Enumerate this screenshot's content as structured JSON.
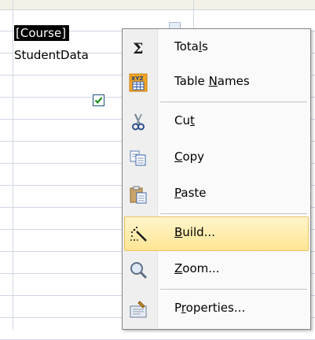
{
  "grid": {
    "cells": {
      "course_field": "[Course]",
      "table_name": "StudentData"
    },
    "checkbox_checked": true
  },
  "context_menu": {
    "items": [
      {
        "pre": "Tota",
        "key": "l",
        "post": "s",
        "icon": "sigma-icon"
      },
      {
        "pre": "Table ",
        "key": "N",
        "post": "ames",
        "icon": "table-names-icon"
      },
      {
        "pre": "Cu",
        "key": "t",
        "post": "",
        "icon": "scissors-icon"
      },
      {
        "pre": "",
        "key": "C",
        "post": "opy",
        "icon": "copy-icon"
      },
      {
        "pre": "",
        "key": "P",
        "post": "aste",
        "icon": "clipboard-icon"
      },
      {
        "pre": "",
        "key": "B",
        "post": "uild...",
        "icon": "build-wand-icon",
        "highlighted": true
      },
      {
        "pre": "",
        "key": "Z",
        "post": "oom...",
        "icon": "magnifier-icon"
      },
      {
        "pre": "P",
        "key": "r",
        "post": "operties...",
        "icon": "properties-icon"
      }
    ]
  },
  "colors": {
    "highlight_top": "#fff5cc",
    "highlight_bottom": "#ffe594",
    "highlight_border": "#e8c567",
    "grid_line": "#d0d7e5",
    "checkbox_check": "#1a8f1a"
  }
}
